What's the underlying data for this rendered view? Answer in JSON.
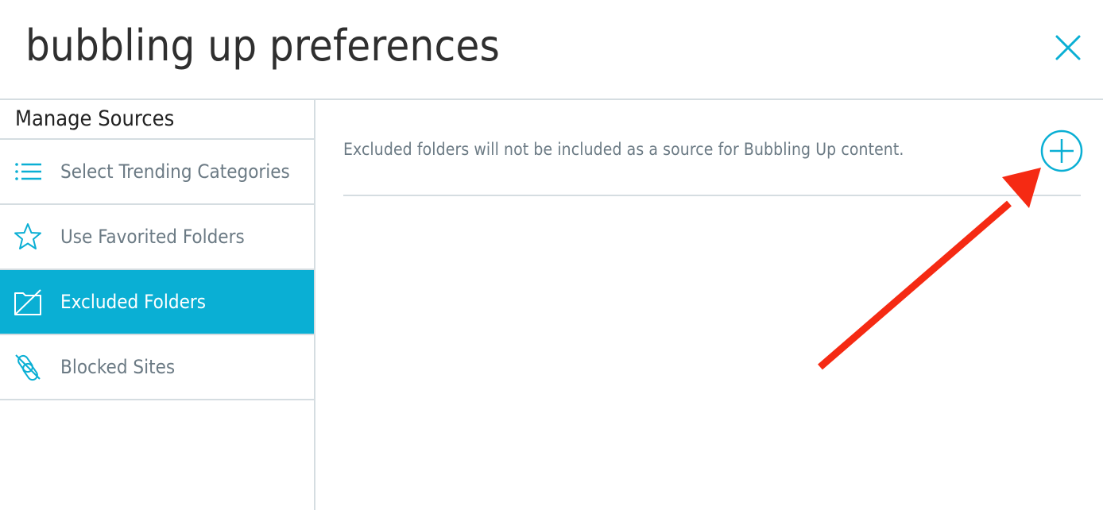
{
  "dialog": {
    "title": "bubbling up preferences",
    "close_icon": "close-icon",
    "accent_color": "#0aafd4"
  },
  "sidebar": {
    "heading": "Manage Sources",
    "items": [
      {
        "label": "Select Trending Categories",
        "icon": "list-icon",
        "active": false
      },
      {
        "label": "Use Favorited Folders",
        "icon": "star-icon",
        "active": false
      },
      {
        "label": "Excluded Folders",
        "icon": "folder-excluded-icon",
        "active": true
      },
      {
        "label": "Blocked Sites",
        "icon": "blocked-site-icon",
        "active": false
      }
    ]
  },
  "main": {
    "description": "Excluded folders will not be included as a source for Bubbling Up content.",
    "add_icon": "add-circle-icon"
  },
  "annotation": {
    "type": "arrow",
    "color": "#f52a13",
    "points_to": "add-button"
  }
}
